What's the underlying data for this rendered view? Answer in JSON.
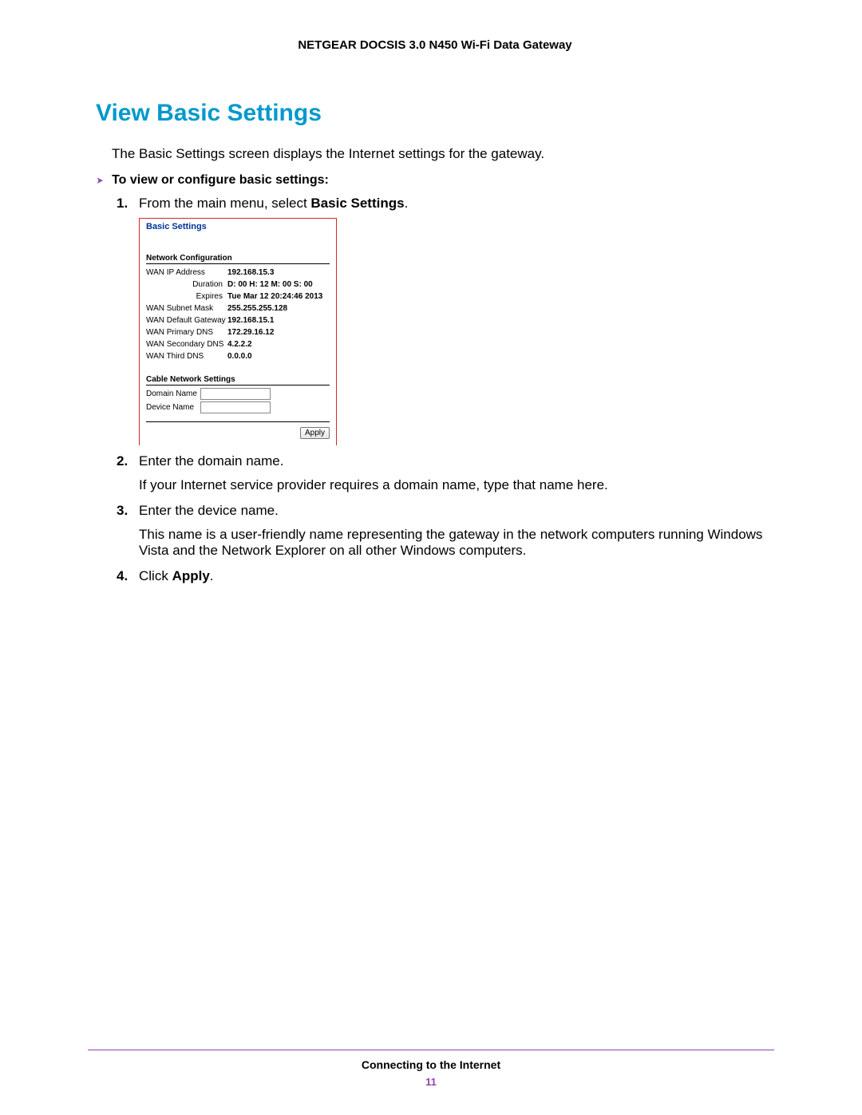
{
  "doc_header": "NETGEAR DOCSIS 3.0 N450 Wi-Fi Data Gateway",
  "heading": "View Basic Settings",
  "intro": "The Basic Settings screen displays the Internet settings for the gateway.",
  "procedure_intro": "To view or configure basic settings:",
  "steps": {
    "s1_pre": "From the main menu, select ",
    "s1_bold": "Basic Settings",
    "s1_post": ".",
    "s2": "Enter the domain name.",
    "s2_sub": "If your Internet service provider requires a domain name, type that name here.",
    "s3": "Enter the device name.",
    "s3_sub": "This name is a user-friendly name representing the gateway in the network computers running Windows Vista and the Network Explorer on all other Windows computers.",
    "s4_pre": "Click ",
    "s4_bold": "Apply",
    "s4_post": "."
  },
  "shot": {
    "title": "Basic Settings",
    "netcfg_head": "Network Configuration",
    "rows": [
      {
        "label": "WAN IP Address",
        "value": "192.168.15.3",
        "right": false
      },
      {
        "label": "Duration",
        "value": "D: 00 H: 12 M: 00 S: 00",
        "right": true
      },
      {
        "label": "Expires",
        "value": "Tue Mar 12 20:24:46 2013",
        "right": true
      },
      {
        "label": "WAN Subnet Mask",
        "value": "255.255.255.128",
        "right": false
      },
      {
        "label": "WAN Default Gateway",
        "value": "192.168.15.1",
        "right": false
      },
      {
        "label": "WAN Primary DNS",
        "value": "172.29.16.12",
        "right": false
      },
      {
        "label": "WAN Secondary DNS",
        "value": "4.2.2.2",
        "right": false
      },
      {
        "label": "WAN Third DNS",
        "value": "0.0.0.0",
        "right": false
      }
    ],
    "cable_head": "Cable Network Settings",
    "domain_label": "Domain Name",
    "device_label": "Device Name",
    "apply_label": "Apply"
  },
  "footer": {
    "section": "Connecting to the Internet",
    "page": "11"
  }
}
